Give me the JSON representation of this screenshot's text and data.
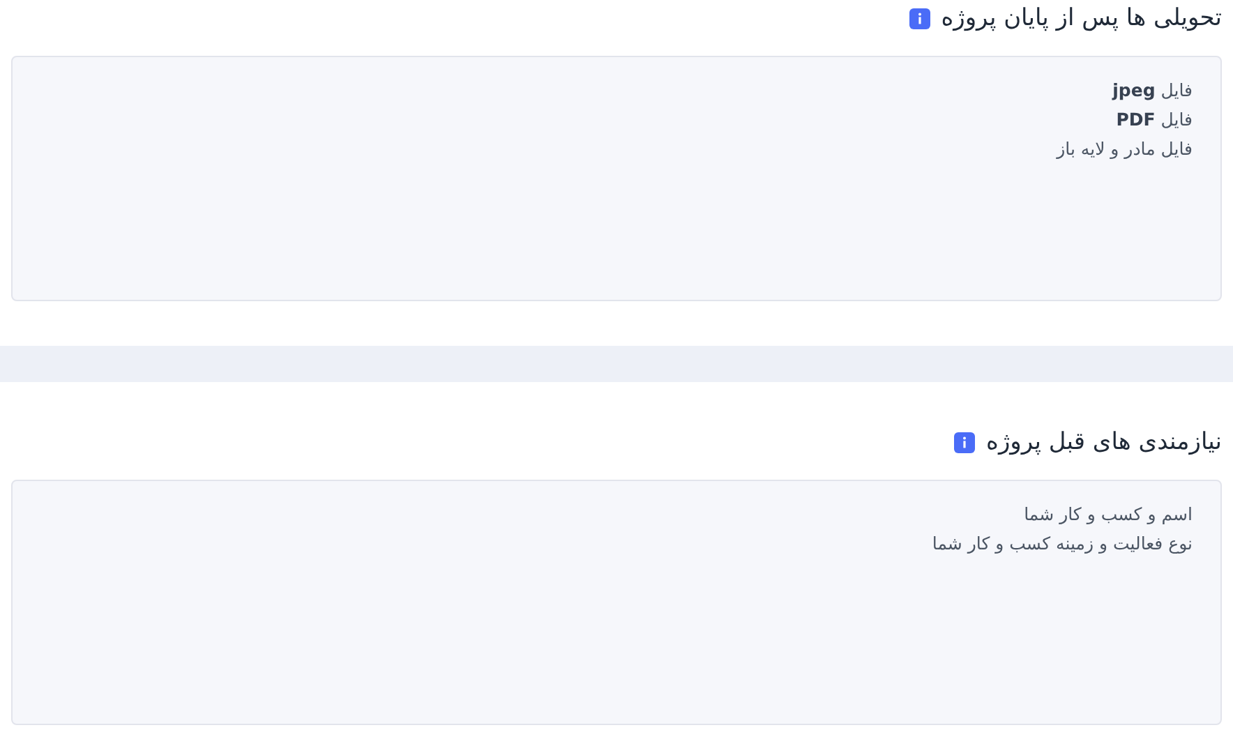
{
  "sections": [
    {
      "title": "تحویلی ها پس از پایان پروژه",
      "lines": [
        "فایل **jpeg**",
        "فایل **PDF**",
        "فایل مادر و لایه باز"
      ]
    },
    {
      "title": "نیازمندی های قبل پروژه",
      "lines": [
        "اسم و کسب و کار شما",
        "نوع فعالیت و زمینه کسب و کار شما"
      ]
    }
  ]
}
